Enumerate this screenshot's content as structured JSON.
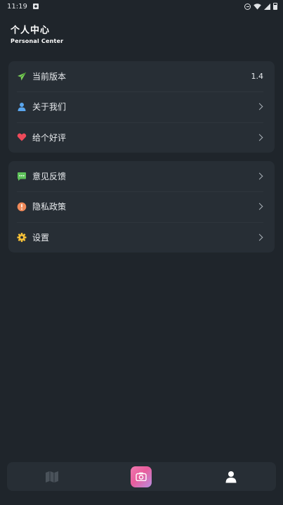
{
  "status_bar": {
    "time": "11:19"
  },
  "header": {
    "title": "个人中心",
    "subtitle": "Personal Center"
  },
  "card_top": {
    "items": [
      {
        "label": "当前版本",
        "value": "1.4",
        "icon": "paper-plane-icon"
      },
      {
        "label": "关于我们",
        "icon": "user-icon"
      },
      {
        "label": "给个好评",
        "icon": "heart-icon"
      }
    ]
  },
  "card_bottom": {
    "items": [
      {
        "label": "意见反馈",
        "icon": "chat-bubble-icon"
      },
      {
        "label": "隐私政策",
        "icon": "alert-icon"
      },
      {
        "label": "设置",
        "icon": "gear-icon"
      }
    ]
  },
  "bottom_nav": {
    "items": [
      {
        "icon": "map-icon",
        "active": false
      },
      {
        "icon": "camera-icon",
        "active": true
      },
      {
        "icon": "profile-icon",
        "active": true
      }
    ]
  },
  "colors": {
    "background": "#1f252b",
    "card": "#272e35",
    "plane_green": "#7ccf5a",
    "user_blue": "#5aa6ee",
    "heart_red": "#ee4a5a",
    "chat_green": "#5ec25a",
    "alert_orange": "#f08a5a",
    "gear_yellow": "#f5c037",
    "camera_pink": "#e85d9c"
  }
}
